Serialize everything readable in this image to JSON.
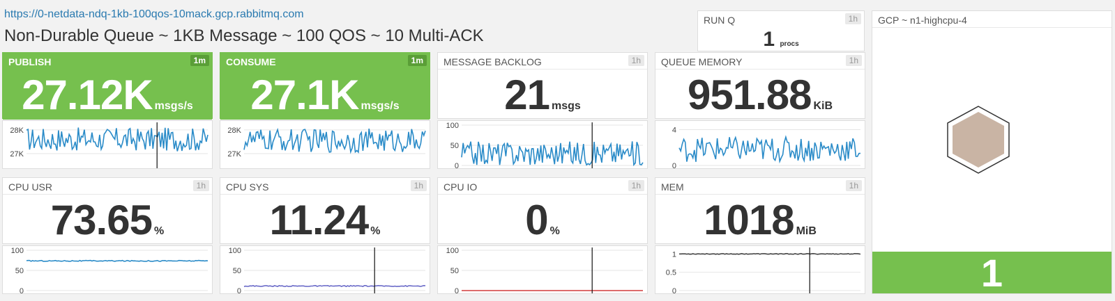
{
  "header": {
    "url": "https://0-netdata-ndq-1kb-100qos-10mack.gcp.rabbitmq.com",
    "title": "Non-Durable Queue ~ 1KB Message ~ 100 QOS ~ 10 Multi-ACK"
  },
  "runq": {
    "label": "RUN Q",
    "badge": "1h",
    "value": "1",
    "unit": "procs"
  },
  "gcp": {
    "label": "GCP ~ n1-highcpu-4",
    "value": "1",
    "hex_icon": "hexagon-icon",
    "hex_fill": "#c9b4a4"
  },
  "colors": {
    "green": "#76c04e",
    "blue_line": "#2a8bc8",
    "purple_line": "#6a6ac8",
    "red_line": "#d23c3c",
    "dark_line": "#444444"
  },
  "panels": [
    {
      "label": "PUBLISH",
      "badge": "1m",
      "value": "27.12K",
      "unit": "msgs/s",
      "green": true,
      "ticks": [
        {
          "label": "28K",
          "value": 28000
        },
        {
          "label": "27K",
          "value": 27000
        }
      ],
      "ymin": 26500,
      "ymax": 28200,
      "line_color": "#2a8bc8",
      "base": 27600,
      "amp": 500,
      "cursor": 0.72
    },
    {
      "label": "CONSUME",
      "badge": "1m",
      "value": "27.1K",
      "unit": "msgs/s",
      "green": true,
      "ticks": [
        {
          "label": "28K",
          "value": 28000
        },
        {
          "label": "27K",
          "value": 27000
        }
      ],
      "ymin": 26500,
      "ymax": 28200,
      "line_color": "#2a8bc8",
      "base": 27550,
      "amp": 500,
      "cursor": null
    },
    {
      "label": "MESSAGE BACKLOG",
      "badge": "1h",
      "value": "21",
      "unit": "msgs",
      "green": false,
      "ticks": [
        {
          "label": "100",
          "value": 100
        },
        {
          "label": "50",
          "value": 50
        },
        {
          "label": "0",
          "value": 0
        }
      ],
      "ymin": 0,
      "ymax": 100,
      "line_color": "#2a8bc8",
      "base": 30,
      "amp": 30,
      "cursor": 0.72
    },
    {
      "label": "QUEUE MEMORY",
      "badge": "1h",
      "value": "951.88",
      "unit": "KiB",
      "green": false,
      "ticks": [
        {
          "label": "4",
          "value": 4
        },
        {
          "label": "0",
          "value": 0
        }
      ],
      "ymin": 0,
      "ymax": 4.5,
      "line_color": "#2a8bc8",
      "base": 1.8,
      "amp": 1.4,
      "cursor": null
    },
    {
      "label": "CPU USR",
      "badge": "1h",
      "value": "73.65",
      "unit": "%",
      "green": false,
      "ticks": [
        {
          "label": "100",
          "value": 100
        },
        {
          "label": "50",
          "value": 50
        },
        {
          "label": "0",
          "value": 0
        }
      ],
      "ymin": 0,
      "ymax": 100,
      "line_color": "#2a8bc8",
      "base": 73.65,
      "amp": 1.2,
      "cursor": null
    },
    {
      "label": "CPU SYS",
      "badge": "1h",
      "value": "11.24",
      "unit": "%",
      "green": false,
      "ticks": [
        {
          "label": "100",
          "value": 100
        },
        {
          "label": "50",
          "value": 50
        },
        {
          "label": "0",
          "value": 0
        }
      ],
      "ymin": 0,
      "ymax": 100,
      "line_color": "#6a6ac8",
      "base": 11.24,
      "amp": 1.2,
      "cursor": 0.72
    },
    {
      "label": "CPU IO",
      "badge": "1h",
      "value": "0",
      "unit": "%",
      "green": false,
      "ticks": [
        {
          "label": "100",
          "value": 100
        },
        {
          "label": "50",
          "value": 50
        },
        {
          "label": "0",
          "value": 0
        }
      ],
      "ymin": 0,
      "ymax": 100,
      "line_color": "#d23c3c",
      "base": 0,
      "amp": 0,
      "cursor": 0.72
    },
    {
      "label": "MEM",
      "badge": "1h",
      "value": "1018",
      "unit": "MiB",
      "green": false,
      "ticks": [
        {
          "label": "1",
          "value": 1
        },
        {
          "label": "0.5",
          "value": 0.5
        },
        {
          "label": "0",
          "value": 0
        }
      ],
      "ymin": 0,
      "ymax": 1.1,
      "line_color": "#444444",
      "base": 1,
      "amp": 0.01,
      "cursor": 0.72
    }
  ]
}
